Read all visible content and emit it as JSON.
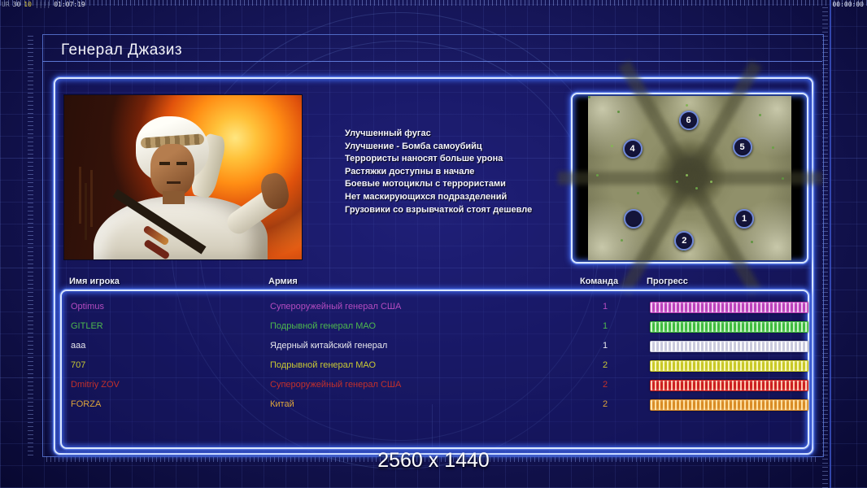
{
  "hud": {
    "top_left_segments": [
      {
        "text": "UR",
        "color": "#8890a8"
      },
      {
        "text": "30",
        "color": "#d8dce8"
      },
      {
        "text": "10",
        "color": "#e0cc40"
      },
      {
        "text": "||||",
        "color": "#6a7298"
      },
      {
        "text": "01:07:19",
        "color": "#e8eaf2"
      }
    ],
    "top_right": "00:00:00"
  },
  "header": {
    "title": "Генерал Джазиз"
  },
  "briefing": {
    "bonuses": [
      "Улучшенный фугас",
      "Улучшение - Бомба самоубийц",
      "Террористы наносят больше урона",
      "Растяжки доступны в начале",
      "Боевые мотоциклы с террористами",
      "Нет маскирующихся подразделений",
      "Грузовики со взрывчаткой стоят дешевле"
    ]
  },
  "map_preview": {
    "markers": [
      {
        "label": "6",
        "x": 48.6,
        "y": 14
      },
      {
        "label": "4",
        "x": 21.0,
        "y": 31
      },
      {
        "label": "5",
        "x": 75.0,
        "y": 30
      },
      {
        "label": "",
        "x": 21.5,
        "y": 74
      },
      {
        "label": "1",
        "x": 76.0,
        "y": 74
      },
      {
        "label": "2",
        "x": 46.5,
        "y": 87
      }
    ]
  },
  "players": {
    "columns": {
      "name": "Имя игрока",
      "army": "Армия",
      "team": "Команда",
      "progress": "Прогресс"
    },
    "rows": [
      {
        "name": "Optimus",
        "army": "Супероружейный генерал США",
        "team": "1",
        "progress": 100,
        "color": "#b44cc0",
        "bar": "#bb3fbb",
        "stripe": "#eec2ee"
      },
      {
        "name": "GITLER",
        "army": "Подрывной генерал МАО",
        "team": "1",
        "progress": 100,
        "color": "#4db84d",
        "bar": "#3dbb3d",
        "stripe": "#c6f2c2"
      },
      {
        "name": "aaa",
        "army": "Ядерный китайский генерал",
        "team": "1",
        "progress": 100,
        "color": "#e8e8ee",
        "bar": "#c9c9dd",
        "stripe": "#ffffff"
      },
      {
        "name": "707",
        "army": "Подрывной генерал МАО",
        "team": "2",
        "progress": 100,
        "color": "#c9c933",
        "bar": "#c9c925",
        "stripe": "#f6f6bb"
      },
      {
        "name": "Dmitriy ZOV",
        "army": "Супероружейный генерал США",
        "team": "2",
        "progress": 100,
        "color": "#c3302b",
        "bar": "#cc1f1f",
        "stripe": "#ffc4ad"
      },
      {
        "name": "FORZA",
        "army": "Китай",
        "team": "2",
        "progress": 100,
        "color": "#dda43b",
        "bar": "#d98c25",
        "stripe": "#ffdf9e"
      }
    ]
  },
  "footer": {
    "resolution": "2560 x 1440"
  }
}
